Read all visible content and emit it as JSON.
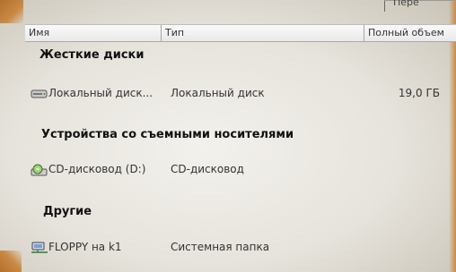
{
  "toolbar": {
    "fragment_text": "Пере"
  },
  "columns": {
    "name": "Имя",
    "type": "Тип",
    "total": "Полный объем"
  },
  "groups": [
    {
      "title": "Жесткие диски",
      "items": [
        {
          "icon": "hard-drive-icon",
          "name": "Локальный диск...",
          "type": "Локальный диск",
          "size": "19,0 ГБ"
        }
      ]
    },
    {
      "title": "Устройства со съемными носителями",
      "items": [
        {
          "icon": "cd-drive-icon",
          "name": "CD-дисковод (D:)",
          "type": "CD-дисковод",
          "size": ""
        }
      ]
    },
    {
      "title": "Другие",
      "items": [
        {
          "icon": "network-folder-icon",
          "name": "FLOPPY на k1",
          "type": "Системная папка",
          "size": ""
        }
      ]
    }
  ]
}
